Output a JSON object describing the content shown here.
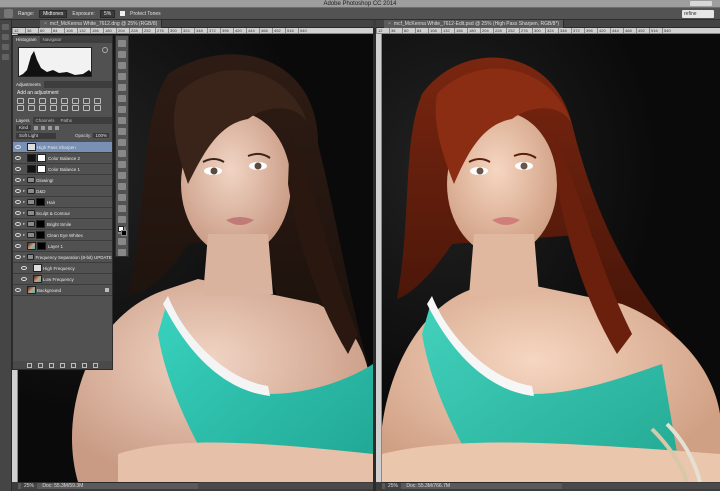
{
  "app": {
    "title": "Adobe Photoshop CC 2014",
    "search_field": "refine"
  },
  "options_bar": {
    "range_label": "Range:",
    "range_value": "Midtones",
    "exposure_label": "Exposure:",
    "exposure_value": "5%",
    "protect_tones_label": "Protect Tones"
  },
  "documents": {
    "left_tab": "mcf_McKenna White_7612.dng @ 25% (RGB/8)",
    "right_tab": "mcf_McKenna White_7612-Edit.psd @ 25% (High Pass Sharpen, RGB/8*)",
    "ruler_ticks": [
      "12",
      "36",
      "60",
      "84",
      "108",
      "132",
      "156",
      "180",
      "204",
      "228",
      "252",
      "276",
      "300",
      "324",
      "348",
      "372",
      "396",
      "420",
      "444",
      "468",
      "492",
      "516",
      "540"
    ],
    "left_status_zoom": "25%",
    "left_status_doc": "Doc: 55.3M/59.3M",
    "right_status_zoom": "25%",
    "right_status_doc": "Doc: 55.3M/766.7M"
  },
  "panels": {
    "histogram_tab": "Histogram",
    "navigator_tab": "Navigator",
    "adjustments_tab": "Adjustments",
    "add_adjustment": "Add an adjustment",
    "layers_tab": "Layers",
    "channels_tab": "Channels",
    "paths_tab": "Paths",
    "kind_filter": "Kind",
    "blend_mode": "Soft Light",
    "opacity_label": "Opacity:",
    "opacity_value": "100%",
    "lock_label": "Lock:",
    "fill_label": "Fill:",
    "fill_value": "100%"
  },
  "layers": [
    {
      "name": "High Pass Sharpen",
      "selected": true,
      "thumb": "gray",
      "mask": "none",
      "indent": 0,
      "twirl": ""
    },
    {
      "name": "Color Balance 2",
      "selected": false,
      "thumb": "adj",
      "mask": "white",
      "indent": 0,
      "twirl": ""
    },
    {
      "name": "Color Balance 1",
      "selected": false,
      "thumb": "adj",
      "mask": "white",
      "indent": 0,
      "twirl": ""
    },
    {
      "name": "Glowing!",
      "selected": false,
      "thumb": "folder",
      "mask": "none",
      "indent": 0,
      "twirl": "▸"
    },
    {
      "name": "D&D",
      "selected": false,
      "thumb": "folder",
      "mask": "none",
      "indent": 0,
      "twirl": "▸"
    },
    {
      "name": "Hair",
      "selected": false,
      "thumb": "folder",
      "mask": "black",
      "indent": 0,
      "twirl": "▸"
    },
    {
      "name": "Sculpt & Contour",
      "selected": false,
      "thumb": "folder",
      "mask": "none",
      "indent": 0,
      "twirl": "▸"
    },
    {
      "name": "Bright Smile",
      "selected": false,
      "thumb": "folder",
      "mask": "black",
      "indent": 0,
      "twirl": "▸"
    },
    {
      "name": "Clean Eye Whites",
      "selected": false,
      "thumb": "folder",
      "mask": "black",
      "indent": 0,
      "twirl": "▸"
    },
    {
      "name": "Layer 1",
      "selected": false,
      "thumb": "photo",
      "mask": "black",
      "indent": 0,
      "twirl": ""
    },
    {
      "name": "Frequency Separation (8-bit) UPDATED",
      "selected": false,
      "thumb": "folder",
      "mask": "none",
      "indent": 0,
      "twirl": "▾"
    },
    {
      "name": "High Frequency",
      "selected": false,
      "thumb": "gray",
      "mask": "none",
      "indent": 1,
      "twirl": ""
    },
    {
      "name": "Low Frequency",
      "selected": false,
      "thumb": "photo",
      "mask": "none",
      "indent": 1,
      "twirl": ""
    },
    {
      "name": "Background",
      "selected": false,
      "thumb": "photo",
      "mask": "none",
      "indent": 0,
      "twirl": "",
      "locked": true
    }
  ],
  "colors": {
    "selection": "#7890b4",
    "top_teal": "#2ec8b2",
    "hair_left": "#3a2318",
    "hair_right": "#7a2610"
  }
}
